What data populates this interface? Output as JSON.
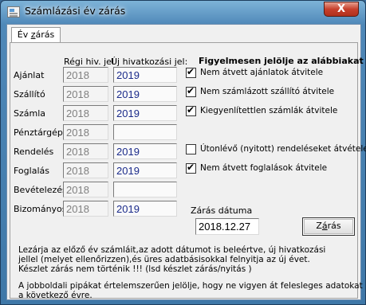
{
  "window": {
    "title": "Számlázási év zárás",
    "close_label": "X"
  },
  "tab": {
    "label_pre": "Év ",
    "label_u": "z",
    "label_post": "árás"
  },
  "headers": {
    "old": "Régi hiv. jel",
    "new": "Új hivatkozási jel:",
    "notice": "Figyelmesen jelölje az alábbiakat"
  },
  "rows": [
    {
      "label": "Ajánlat",
      "old": "2018",
      "new": "2019"
    },
    {
      "label": "Szállító",
      "old": "2018",
      "new": "2019"
    },
    {
      "label": "Számla",
      "old": "2018",
      "new": "2019"
    },
    {
      "label": "Pénztárgép",
      "old": "2018",
      "new": ""
    },
    {
      "label": "Rendelés",
      "old": "2018",
      "new": "2019"
    },
    {
      "label": "Foglalás",
      "old": "2018",
      "new": "2019"
    },
    {
      "label": "Bevételezés",
      "old": "2018",
      "new": ""
    },
    {
      "label": "Bizományosi",
      "old": "2018",
      "new": "2019"
    }
  ],
  "options": [
    {
      "label": "Nem átvett ajánlatok átvitele",
      "checked": true
    },
    {
      "label": "Nem számlázott szállító átvitele",
      "checked": true
    },
    {
      "label": "Kiegyenlítettlen számlák átvitele",
      "checked": true
    },
    {
      "label": "Útonlévő (nyitott) rendeléseket átvétele.",
      "checked": false
    },
    {
      "label": "Nem átvett  foglalások átvitele",
      "checked": true
    }
  ],
  "closing": {
    "date_label": "Zárás dátuma",
    "date_value": "2018.12.27",
    "button_pre": "Z",
    "button_u": "á",
    "button_post": "rás"
  },
  "info": {
    "line1": "Lezárja az előző év számláit,az adott dátumot is beleértve,  új hivatkozási",
    "line2": "jellel  (melyet ellenőrizzen),és üres adatbásisokkal felnyitja az új évet.",
    "line3": "Készlet zárás nem történik !!! (lsd készlet zárás/nyitás )",
    "line4": "A jobboldali pipákat értelemszerűen jelölje, hogy ne vigyen át felesleges adatokat",
    "line5": "a következő évre."
  }
}
